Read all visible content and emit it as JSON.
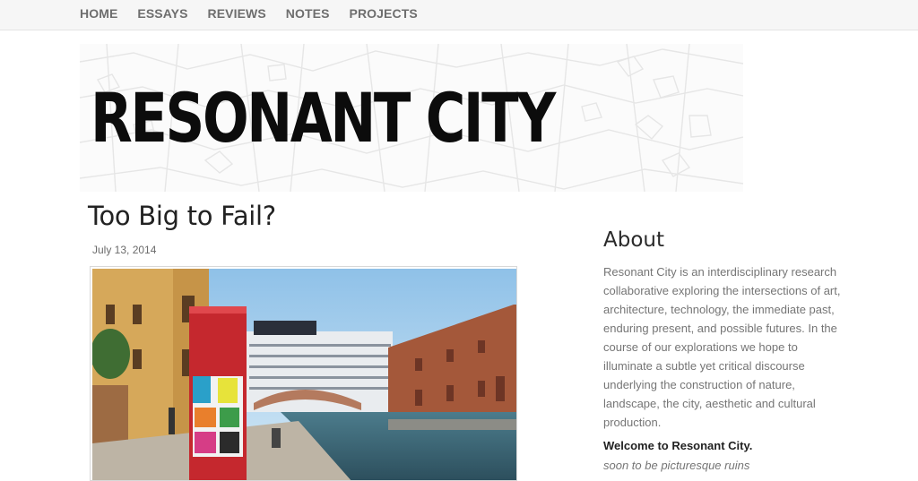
{
  "nav": {
    "items": [
      {
        "label": "HOME"
      },
      {
        "label": "ESSAYS"
      },
      {
        "label": "REVIEWS"
      },
      {
        "label": "NOTES"
      },
      {
        "label": "PROJECTS"
      }
    ]
  },
  "header": {
    "site_title": "RESONANT CITY"
  },
  "post": {
    "title": "Too Big to Fail?",
    "date": "July 13, 2014",
    "image_alt": "Canal scene with cruise ship and red kiosk"
  },
  "sidebar": {
    "about_heading": "About",
    "about_text": "Resonant City is an interdisciplinary research collaborative exploring the intersections of art, architecture, technology, the immediate past, enduring present, and possible futures. In the course of our explorations we hope to illuminate a subtle yet critical discourse underlying the construction of nature, landscape, the city, aesthetic and cultural production.",
    "welcome": "Welcome to Resonant City.",
    "tagline": "soon to be picturesque ruins"
  },
  "colors": {
    "nav_bg": "#f6f6f6",
    "nav_text": "#6e6e6e",
    "title_black": "#0c0c0c",
    "body_gray": "#757575"
  }
}
